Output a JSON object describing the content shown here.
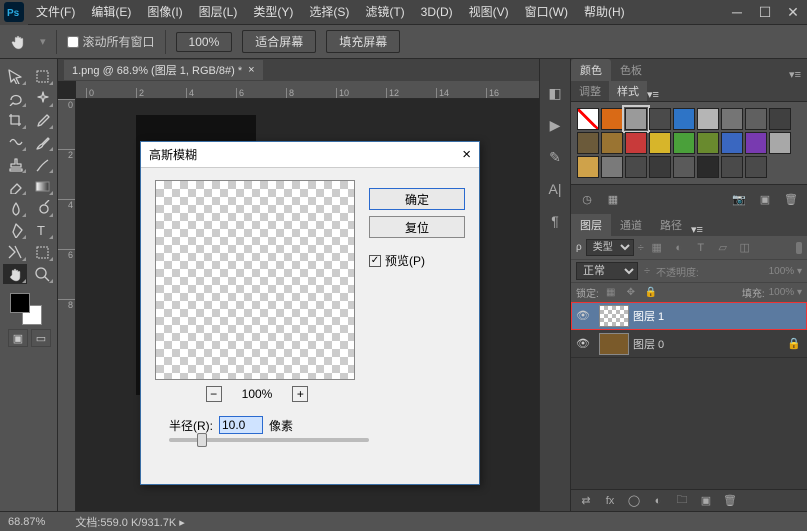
{
  "menubar": {
    "items": [
      "文件(F)",
      "编辑(E)",
      "图像(I)",
      "图层(L)",
      "类型(Y)",
      "选择(S)",
      "滤镜(T)",
      "3D(D)",
      "视图(V)",
      "窗口(W)",
      "帮助(H)"
    ]
  },
  "optionbar": {
    "scroll_all": "滚动所有窗口",
    "zoom_value": "100%",
    "fit_screen": "适合屏幕",
    "fill_screen": "填充屏幕"
  },
  "document": {
    "tab_title": "1.png @ 68.9% (图层 1, RGB/8#) *",
    "ruler_h": [
      "0",
      "2",
      "4",
      "6",
      "8",
      "10",
      "12",
      "14",
      "16"
    ],
    "ruler_v": [
      "0",
      "2",
      "4",
      "6",
      "8"
    ]
  },
  "dialog": {
    "title": "高斯模糊",
    "ok": "确定",
    "reset": "复位",
    "preview": "预览(P)",
    "zoom": "100%",
    "radius_label": "半径(R):",
    "radius_value": "10.0",
    "radius_unit": "像素"
  },
  "panels": {
    "color_tab": "颜色",
    "swatch_tab": "色板",
    "adjust_tab": "调整",
    "styles_tab": "样式",
    "layers_tab": "图层",
    "channels_tab": "通道",
    "paths_tab": "路径",
    "type_label": "类型",
    "blend_mode": "正常",
    "opacity_label": "不透明度:",
    "opacity_value": "100%",
    "lock_label": "锁定:",
    "fill_label": "填充:",
    "fill_value": "100%",
    "layers": [
      {
        "name": "图层 1",
        "active": true,
        "thumb": "checker",
        "locked": false
      },
      {
        "name": "图层 0",
        "active": false,
        "thumb": "img",
        "locked": true
      }
    ],
    "styles_colors": [
      "none",
      "#d96a16",
      "#9a9a9a",
      "#4a4a4a",
      "#2e74c6",
      "#b5b5b5",
      "#757575",
      "#606060",
      "#404040",
      "#6b5a3a",
      "#9a7432",
      "#c83a3a",
      "#d7b52a",
      "#4aa03a",
      "#698a2e",
      "#3a67c0",
      "#783ab0",
      "#a8a8a8",
      "#cfa24a",
      "#7a7a7a",
      "",
      "#3a3a3a",
      "#5a5a5a",
      "#2a2a2a",
      "",
      ""
    ]
  },
  "statusbar": {
    "zoom": "68.87%",
    "doc_info": "文档:559.0 K/931.7K"
  }
}
